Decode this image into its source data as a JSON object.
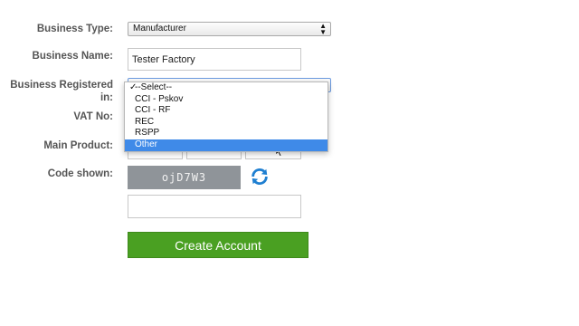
{
  "form": {
    "business_type": {
      "label": "Business Type:",
      "value": "Manufacturer"
    },
    "business_name": {
      "label": "Business Name:",
      "value": "Tester Factory"
    },
    "registered_in": {
      "label_line1": "Business Registered",
      "label_line2": "in:",
      "value": "--Select--",
      "options": [
        "--Select--",
        "CCI - Pskov",
        "CCI - RF",
        "REC",
        "RSPP",
        "Other"
      ],
      "highlighted": "Other"
    },
    "vat_no": {
      "label": "VAT No:"
    },
    "main_product": {
      "label": "Main Product:"
    },
    "code": {
      "label": "Code shown:",
      "captcha_text": "ojD7W3",
      "refresh_icon": "refresh-icon"
    },
    "submit_label": "Create Account"
  },
  "colors": {
    "accent_green": "#4aa022",
    "highlight_blue": "#3f8ae8",
    "captcha_bg": "#8f9499"
  }
}
